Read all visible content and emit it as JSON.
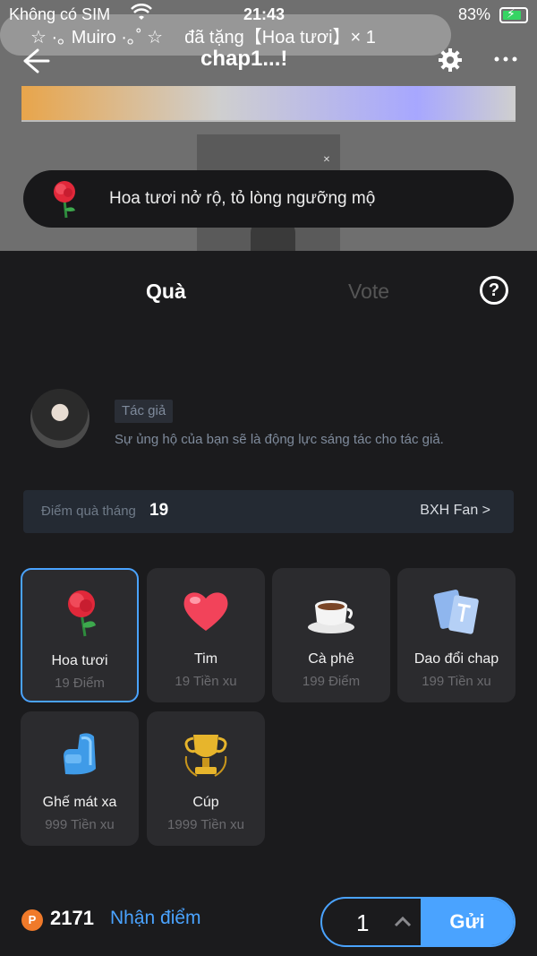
{
  "status_bar": {
    "carrier": "Không có SIM",
    "time": "21:43",
    "battery_pct": "83%",
    "battery_level": 0.83
  },
  "marquee": {
    "user": "☆ ·｡ Muiro ·｡˚ ☆",
    "message": "đã tặng【Hoa tươi】× 1"
  },
  "navbar": {
    "title": "chap1...!"
  },
  "toast": {
    "text": "Hoa tươi nở rộ, tỏ lòng ngưỡng mộ"
  },
  "tabs": [
    {
      "label": "Quà",
      "active": true
    },
    {
      "label": "Vote",
      "active": false
    }
  ],
  "author": {
    "tag": "Tác giả",
    "description": "Sự ủng hộ của bạn sẽ là động lực sáng tác cho tác giả."
  },
  "points": {
    "label": "Điểm quà tháng",
    "value": "19",
    "rank_link": "BXH Fan >"
  },
  "gifts": [
    {
      "name": "Hoa tươi",
      "price": "19 Điểm",
      "icon": "rose-icon",
      "selected": true
    },
    {
      "name": "Tim",
      "price": "19 Tiền xu",
      "icon": "heart-icon",
      "selected": false
    },
    {
      "name": "Cà phê",
      "price": "199 Điểm",
      "icon": "coffee-icon",
      "selected": false
    },
    {
      "name": "Dao đổi chap",
      "price": "199 Tiền xu",
      "icon": "tickets-icon",
      "selected": false
    },
    {
      "name": "Ghế mát xa",
      "price": "999 Tiền xu",
      "icon": "massage-chair-icon",
      "selected": false
    },
    {
      "name": "Cúp",
      "price": "1999 Tiền xu",
      "icon": "trophy-icon",
      "selected": false
    }
  ],
  "footer": {
    "coin_symbol": "P",
    "balance": "2171",
    "earn_label": "Nhận điểm",
    "quantity": "1",
    "send_label": "Gửi"
  },
  "colors": {
    "accent": "#4aa3ff",
    "sheet_bg": "#1b1b1d",
    "card_bg": "#2b2b2e",
    "coin": "#f07a2a"
  }
}
